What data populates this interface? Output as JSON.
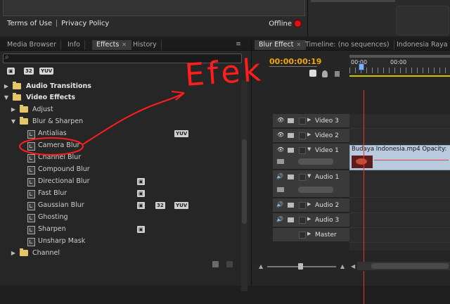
{
  "top": {
    "terms_link": "Terms of Use",
    "privacy_link": "Privacy Policy",
    "status": "Offline"
  },
  "left_panel": {
    "tabs": [
      "Media Browser",
      "Info",
      "Effects",
      "History"
    ],
    "active_tab": "Effects",
    "search_placeholder": "",
    "filter_badges": [
      "32",
      "YUV"
    ],
    "tree": [
      {
        "label": "Audio Transitions",
        "bold": true,
        "level": 0,
        "kind": "folder",
        "expanded": false
      },
      {
        "label": "Video Effects",
        "bold": true,
        "level": 0,
        "kind": "folder",
        "expanded": true
      },
      {
        "label": "Adjust",
        "level": 1,
        "kind": "folder",
        "expanded": false
      },
      {
        "label": "Blur & Sharpen",
        "level": 1,
        "kind": "folder",
        "expanded": true
      },
      {
        "label": "Antialias",
        "level": 2,
        "kind": "effect",
        "badges": [
          "YUV"
        ]
      },
      {
        "label": "Camera Blur",
        "level": 2,
        "kind": "effect",
        "badges": []
      },
      {
        "label": "Channel Blur",
        "level": 2,
        "kind": "effect",
        "badges": []
      },
      {
        "label": "Compound Blur",
        "level": 2,
        "kind": "effect",
        "badges": []
      },
      {
        "label": "Directional Blur",
        "level": 2,
        "kind": "effect",
        "badges": [
          "acc"
        ]
      },
      {
        "label": "Fast Blur",
        "level": 2,
        "kind": "effect",
        "badges": [
          "acc"
        ]
      },
      {
        "label": "Gaussian Blur",
        "level": 2,
        "kind": "effect",
        "badges": [
          "acc",
          "32",
          "YUV"
        ]
      },
      {
        "label": "Ghosting",
        "level": 2,
        "kind": "effect",
        "badges": []
      },
      {
        "label": "Sharpen",
        "level": 2,
        "kind": "effect",
        "badges": [
          "acc"
        ]
      },
      {
        "label": "Unsharp Mask",
        "level": 2,
        "kind": "effect",
        "badges": []
      },
      {
        "label": "Channel",
        "level": 1,
        "kind": "folder",
        "expanded": false
      }
    ]
  },
  "right_panel": {
    "tabs": [
      "Blur Effect",
      "Timeline: (no sequences)",
      "Indonesia Raya ve"
    ],
    "active_tab": "Blur Effect",
    "timecode": "00:00:00:19",
    "ruler_labels": [
      "00:00",
      "00:00"
    ],
    "tracks": [
      {
        "name": "Video 3",
        "type": "video"
      },
      {
        "name": "Video 2",
        "type": "video"
      },
      {
        "name": "Video 1",
        "type": "video",
        "expanded": true
      },
      {
        "name": "Audio 1",
        "type": "audio",
        "expanded": true
      },
      {
        "name": "Audio 2",
        "type": "audio"
      },
      {
        "name": "Audio 3",
        "type": "audio"
      },
      {
        "name": "Master",
        "type": "master"
      }
    ],
    "clip_title": "Budaya Indonesia.mp4  Opacity:"
  },
  "annotation": {
    "text": "Efek",
    "color": "#ff1d1d"
  }
}
